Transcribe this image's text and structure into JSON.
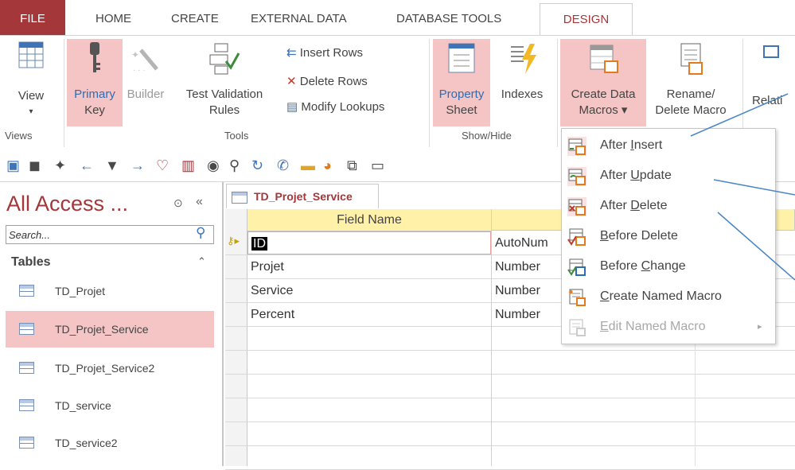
{
  "tabs": {
    "file": "FILE",
    "home": "HOME",
    "create": "CREATE",
    "external_data": "EXTERNAL DATA",
    "database_tools": "DATABASE TOOLS",
    "design": "DESIGN"
  },
  "ribbon": {
    "views": {
      "view": "View",
      "group": "Views"
    },
    "tools": {
      "primary_key_1": "Primary",
      "primary_key_2": "Key",
      "builder": "Builder",
      "test_validation_1": "Test Validation",
      "test_validation_2": "Rules",
      "insert_rows": "Insert Rows",
      "delete_rows": "Delete Rows",
      "modify_lookups": "Modify Lookups",
      "group": "Tools"
    },
    "show_hide": {
      "property_1": "Property",
      "property_2": "Sheet",
      "indexes": "Indexes",
      "group": "Show/Hide"
    },
    "events": {
      "create_data_1": "Create Data",
      "create_data_2": "Macros",
      "rename_1": "Rename/",
      "rename_2": "Delete Macro"
    },
    "relationships_partial": "Relati"
  },
  "nav": {
    "title": "All Access ...",
    "search_placeholder": "Search...",
    "section": "Tables",
    "items": [
      {
        "label": "TD_Projet"
      },
      {
        "label": "TD_Projet_Service"
      },
      {
        "label": "TD_Projet_Service2"
      },
      {
        "label": "TD_service"
      },
      {
        "label": "TD_service2"
      }
    ]
  },
  "document": {
    "tab_title": "TD_Projet_Service",
    "columns": {
      "field_name": "Field Name",
      "data_type_partial": "D"
    },
    "rows": [
      {
        "field": "ID",
        "type": "AutoNum"
      },
      {
        "field": "Projet",
        "type": "Number"
      },
      {
        "field": "Service",
        "type": "Number"
      },
      {
        "field": "Percent",
        "type": "Number"
      }
    ]
  },
  "menu": {
    "items": [
      {
        "pre": "After ",
        "key": "I",
        "post": "nsert",
        "enabled": true
      },
      {
        "pre": "After ",
        "key": "U",
        "post": "pdate",
        "enabled": true
      },
      {
        "pre": "After ",
        "key": "D",
        "post": "elete",
        "enabled": true
      },
      {
        "pre": "",
        "key": "B",
        "post": "efore Delete",
        "enabled": true
      },
      {
        "pre": "Before ",
        "key": "C",
        "post": "hange",
        "enabled": true
      },
      {
        "pre": "",
        "key": "C",
        "post": "reate Named Macro",
        "enabled": true
      },
      {
        "pre": "",
        "key": "E",
        "post": "dit Named Macro",
        "enabled": false
      }
    ]
  },
  "colors": {
    "accent": "#a4373a",
    "highlight": "#f5c4c4",
    "header": "#fff1a8",
    "annotation": "#4a86c5"
  }
}
